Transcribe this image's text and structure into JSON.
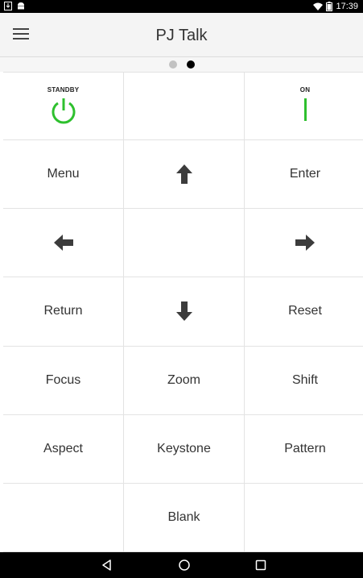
{
  "status_bar": {
    "time": "17:39",
    "left_icons": [
      "download-icon",
      "android-icon"
    ],
    "right_icons": [
      "wifi-icon",
      "battery-icon"
    ]
  },
  "app_bar": {
    "title": "PJ Talk",
    "menu_icon": "hamburger-menu-icon"
  },
  "pager": {
    "page_count": 2,
    "current_page": 2
  },
  "remote": {
    "standby_label": "STANDBY",
    "on_label": "ON",
    "menu": "Menu",
    "enter": "Enter",
    "return": "Return",
    "reset": "Reset",
    "focus": "Focus",
    "zoom": "Zoom",
    "shift": "Shift",
    "aspect": "Aspect",
    "keystone": "Keystone",
    "pattern": "Pattern",
    "blank": "Blank"
  },
  "colors": {
    "accent_green": "#2ec02e",
    "arrow_gray": "#3c3c3c",
    "status_bar": "#000000",
    "app_bar": "#f4f4f4"
  },
  "nav_bar": {
    "icons": [
      "back-icon",
      "home-icon",
      "recents-icon"
    ]
  }
}
